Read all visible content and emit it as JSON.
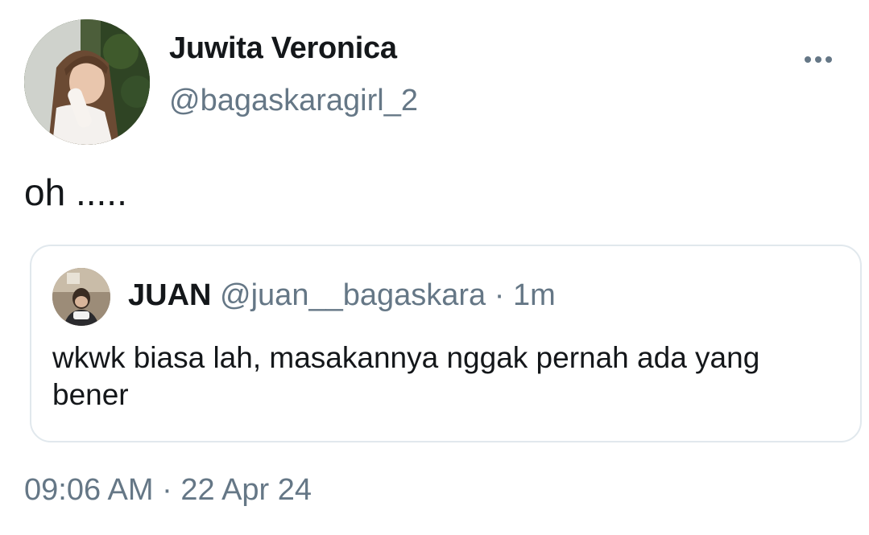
{
  "author": {
    "display_name": "Juwita Veronica",
    "handle": "@bagaskaragirl_2",
    "avatar_icon": "user-avatar-photo"
  },
  "menu": {
    "icon": "more-options-icon"
  },
  "tweet": {
    "text": "oh ....."
  },
  "quoted_tweet": {
    "display_name": "JUAN",
    "handle": "@juan__bagaskara",
    "separator": "·",
    "time": "1m",
    "text": "wkwk biasa lah, masakannya nggak pernah ada yang bener",
    "avatar_icon": "user-avatar-photo"
  },
  "meta": {
    "time": "09:06 AM",
    "separator": "·",
    "date": "22 Apr 24"
  },
  "colors": {
    "text_primary": "#14171a",
    "text_secondary": "#657786",
    "border": "#e1e8ed",
    "background": "#ffffff"
  }
}
